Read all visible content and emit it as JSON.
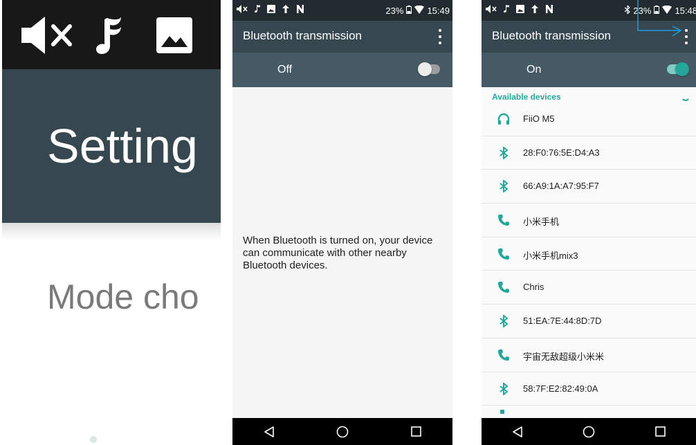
{
  "panel1": {
    "title": "Setting",
    "subtitle": "Mode cho",
    "icons": [
      "mute-icon",
      "music-note-icon",
      "image-icon"
    ]
  },
  "panel2": {
    "status": {
      "battery": "23%",
      "time": "15:49"
    },
    "toolbar_title": "Bluetooth transmission",
    "switch_label": "Off",
    "switch_on": false,
    "message": "When Bluetooth is turned on, your device can communicate with other nearby Bluetooth devices."
  },
  "panel3": {
    "status": {
      "battery": "23%",
      "time": "15:48"
    },
    "toolbar_title": "Bluetooth transmission",
    "switch_label": "On",
    "switch_on": true,
    "section_header": "Available devices",
    "devices": [
      {
        "name": "FiiO M5",
        "icon": "headphones-icon"
      },
      {
        "name": "28:F0:76:5E:D4:A3",
        "icon": "bluetooth-icon"
      },
      {
        "name": "66:A9:1A:A7:95:F7",
        "icon": "bluetooth-icon"
      },
      {
        "name": "小米手机",
        "icon": "phone-icon"
      },
      {
        "name": "小米手机mix3",
        "icon": "phone-icon"
      },
      {
        "name": "Chris",
        "icon": "phone-icon"
      },
      {
        "name": "51:EA:7E:44:8D:7D",
        "icon": "bluetooth-icon"
      },
      {
        "name": "宇宙无敌超级小米米",
        "icon": "phone-icon"
      },
      {
        "name": "58:7F:E2:82:49:0A",
        "icon": "bluetooth-icon"
      }
    ]
  },
  "colors": {
    "statusbar": "#222b30",
    "toolbar": "#37474f",
    "switchbar": "#455a64",
    "accent": "#26a69a",
    "callout": "#1e9be0"
  }
}
